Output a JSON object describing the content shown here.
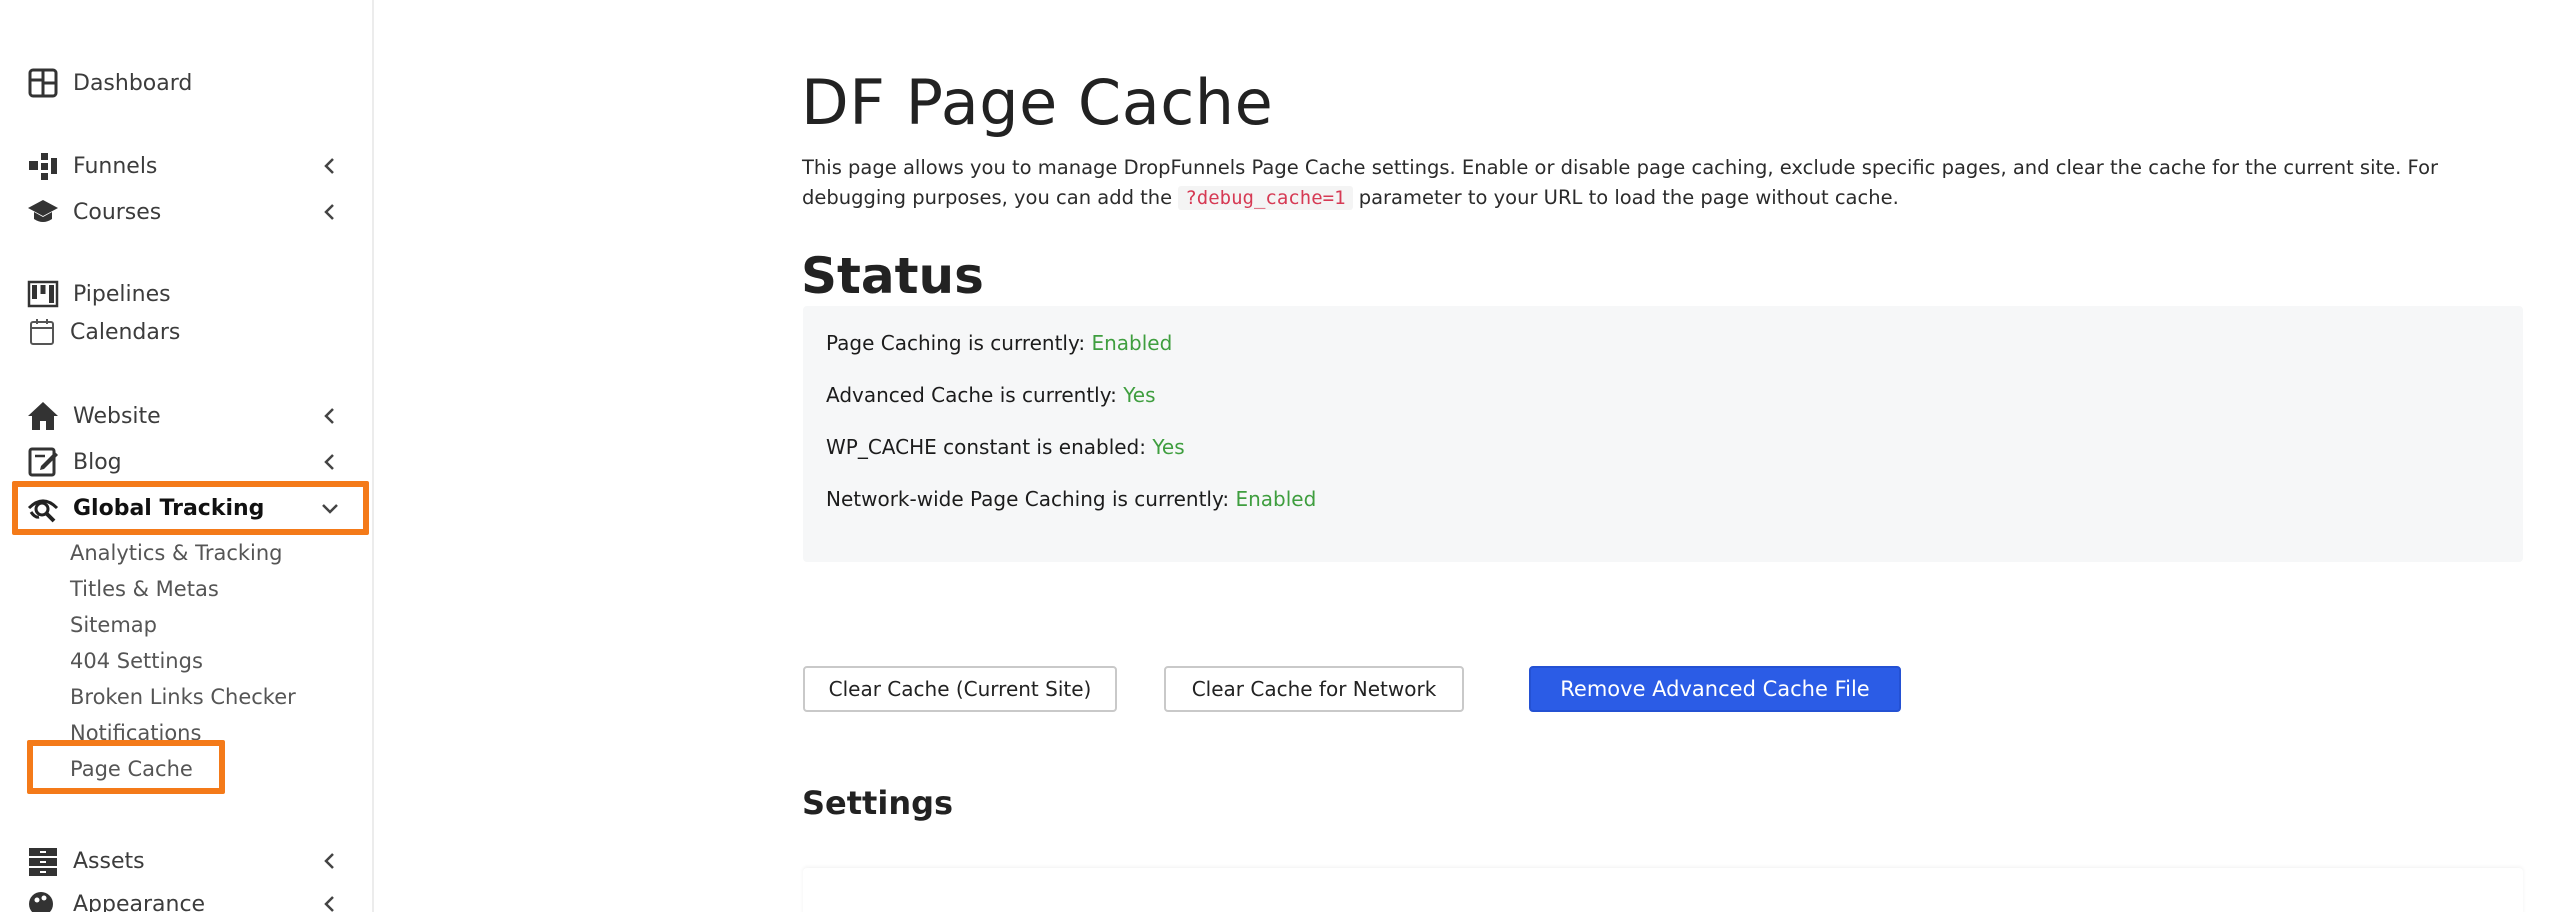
{
  "sidebar": {
    "items": [
      {
        "label": "Dashboard",
        "icon": "dashboard-icon"
      },
      {
        "label": "Funnels",
        "icon": "funnels-icon"
      },
      {
        "label": "Courses",
        "icon": "courses-icon"
      },
      {
        "label": "Pipelines",
        "icon": "pipelines-icon"
      },
      {
        "label": "Calendars",
        "icon": "calendar-icon"
      },
      {
        "label": "Website",
        "icon": "home-icon"
      },
      {
        "label": "Blog",
        "icon": "blog-icon"
      },
      {
        "label": "Global Tracking",
        "icon": "tracking-icon"
      },
      {
        "label": "Assets",
        "icon": "assets-icon"
      },
      {
        "label": "Appearance",
        "icon": "appearance-icon"
      }
    ],
    "sub_items": [
      "Analytics & Tracking",
      "Titles & Metas",
      "Sitemap",
      "404 Settings",
      "Broken Links Checker",
      "Notifications",
      "Page Cache"
    ]
  },
  "main": {
    "title": "DF Page Cache",
    "intro_part1": "This page allows you to manage DropFunnels Page Cache settings. Enable or disable page caching, exclude specific pages, and clear the cache for the current site. For debugging purposes, you can add the ",
    "intro_code": "?debug_cache=1",
    "intro_part2": " parameter to your URL to load the page without cache.",
    "status_title": "Status",
    "status_rows": [
      {
        "label": "Page Caching is currently: ",
        "value": "Enabled"
      },
      {
        "label": "Advanced Cache is currently: ",
        "value": "Yes"
      },
      {
        "label": "WP_CACHE constant is enabled: ",
        "value": "Yes"
      },
      {
        "label": "Network-wide Page Caching is currently: ",
        "value": "Enabled"
      }
    ],
    "buttons": {
      "clear_current": "Clear Cache (Current Site)",
      "clear_network": "Clear Cache for Network",
      "remove_advanced": "Remove Advanced Cache File"
    },
    "settings_title": "Settings"
  },
  "colors": {
    "highlight": "#f47a19",
    "primary": "#2b5ce6",
    "success": "#3f9e3f",
    "code": "#d63a54"
  }
}
